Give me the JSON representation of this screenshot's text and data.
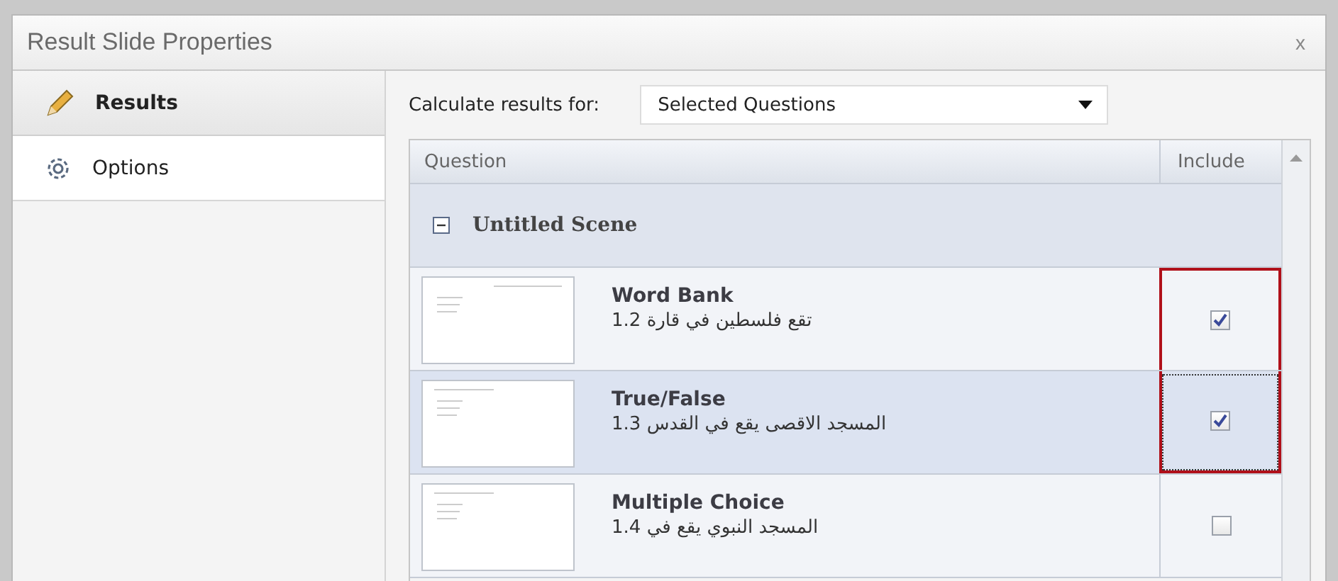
{
  "window": {
    "title": "Result Slide Properties",
    "close": "x"
  },
  "sidebar": {
    "items": [
      {
        "label": "Results",
        "kind": "pencil",
        "selected": true
      },
      {
        "label": "Options",
        "kind": "gear",
        "selected": false
      }
    ]
  },
  "calculate": {
    "label": "Calculate results for:",
    "value": "Selected Questions"
  },
  "table": {
    "columns": [
      "Question",
      "Include"
    ],
    "group": {
      "label": "Untitled Scene",
      "expanded": true
    },
    "rows": [
      {
        "title": "Word Bank",
        "subtitle": "تقع فلسطين في قارة 1.2",
        "include": true,
        "selected": false,
        "highlighted": true
      },
      {
        "title": "True/False",
        "subtitle": "المسجد الاقصى يقع في القدس 1.3",
        "include": true,
        "selected": true,
        "highlighted": true
      },
      {
        "title": "Multiple Choice",
        "subtitle": "المسجد النبوي يقع في 1.4",
        "include": false,
        "selected": false,
        "highlighted": false
      }
    ]
  }
}
